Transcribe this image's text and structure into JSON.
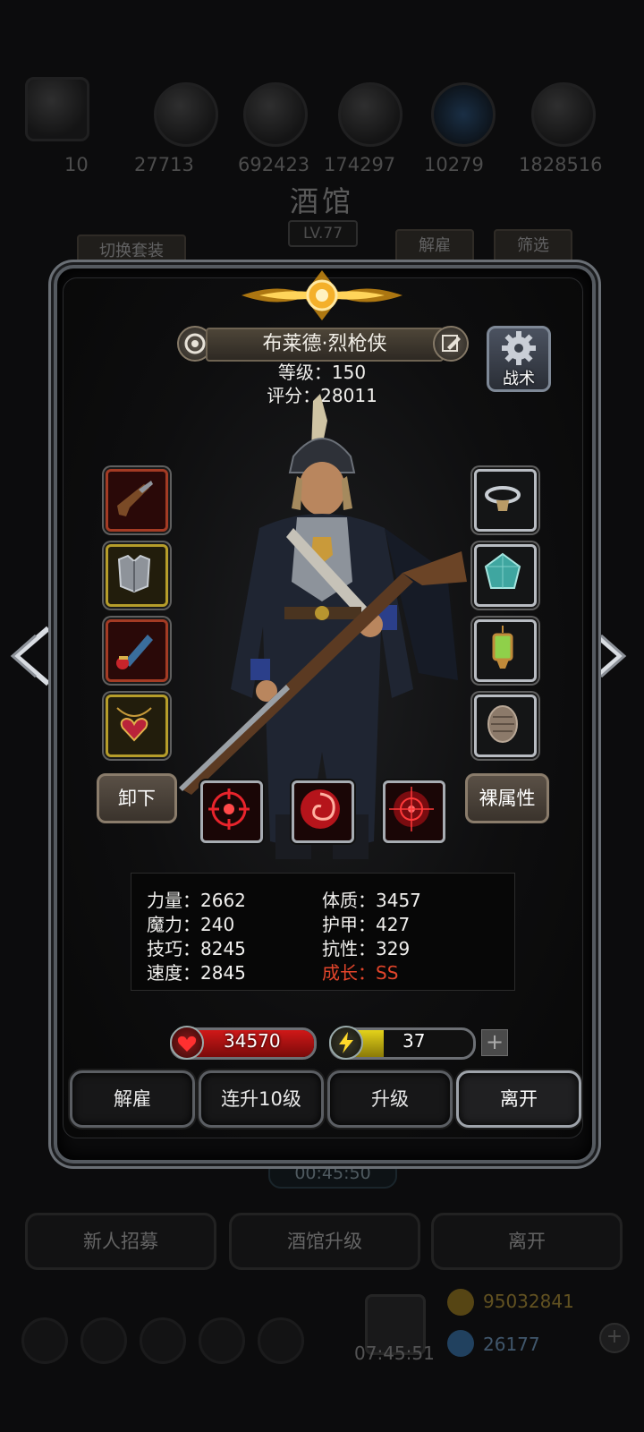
{
  "background": {
    "resources": [
      "10",
      "27713",
      "692423",
      "174297",
      "10279",
      "1828516"
    ],
    "tavern_title": "酒馆",
    "tavern_level": "LV.77",
    "tabs": {
      "switch_set": "切换套装",
      "dismiss": "解雇",
      "filter": "筛选"
    },
    "timer": "00:45:50",
    "bottom_buttons": [
      "新人招募",
      "酒馆升级",
      "离开"
    ],
    "gold": "95032841",
    "gems": "26177",
    "clock": "07:45:51"
  },
  "hero": {
    "name": "布莱德·烈枪侠",
    "level_line": "等级：150",
    "score_line": "评分：28011",
    "tactics_label": "战术"
  },
  "equipment": {
    "left": [
      "musket-pistol",
      "steel-chest-armor",
      "blue-scroll",
      "heart-amulet"
    ],
    "right": [
      "silver-ring",
      "teal-gem",
      "green-lantern",
      "stone-shell"
    ]
  },
  "buttons": {
    "unequip": "卸下",
    "base_attributes": "裸属性"
  },
  "skills": [
    "crosshair-skill",
    "red-swirl-skill",
    "target-skill"
  ],
  "stats": {
    "strength": "力量：2662",
    "constitution": "体质：3457",
    "magic": "魔力：240",
    "armor": "护甲：427",
    "skill": "技巧：8245",
    "resistance": "抗性：329",
    "speed": "速度：2845",
    "growth": "成长：SS"
  },
  "hp": {
    "value": "34570",
    "fill": 1.0,
    "color": "#d01818"
  },
  "energy": {
    "value": "37",
    "fill": 0.37,
    "color": "#e3d21a"
  },
  "actions": [
    "解雇",
    "连升10级",
    "升级",
    "离开"
  ]
}
